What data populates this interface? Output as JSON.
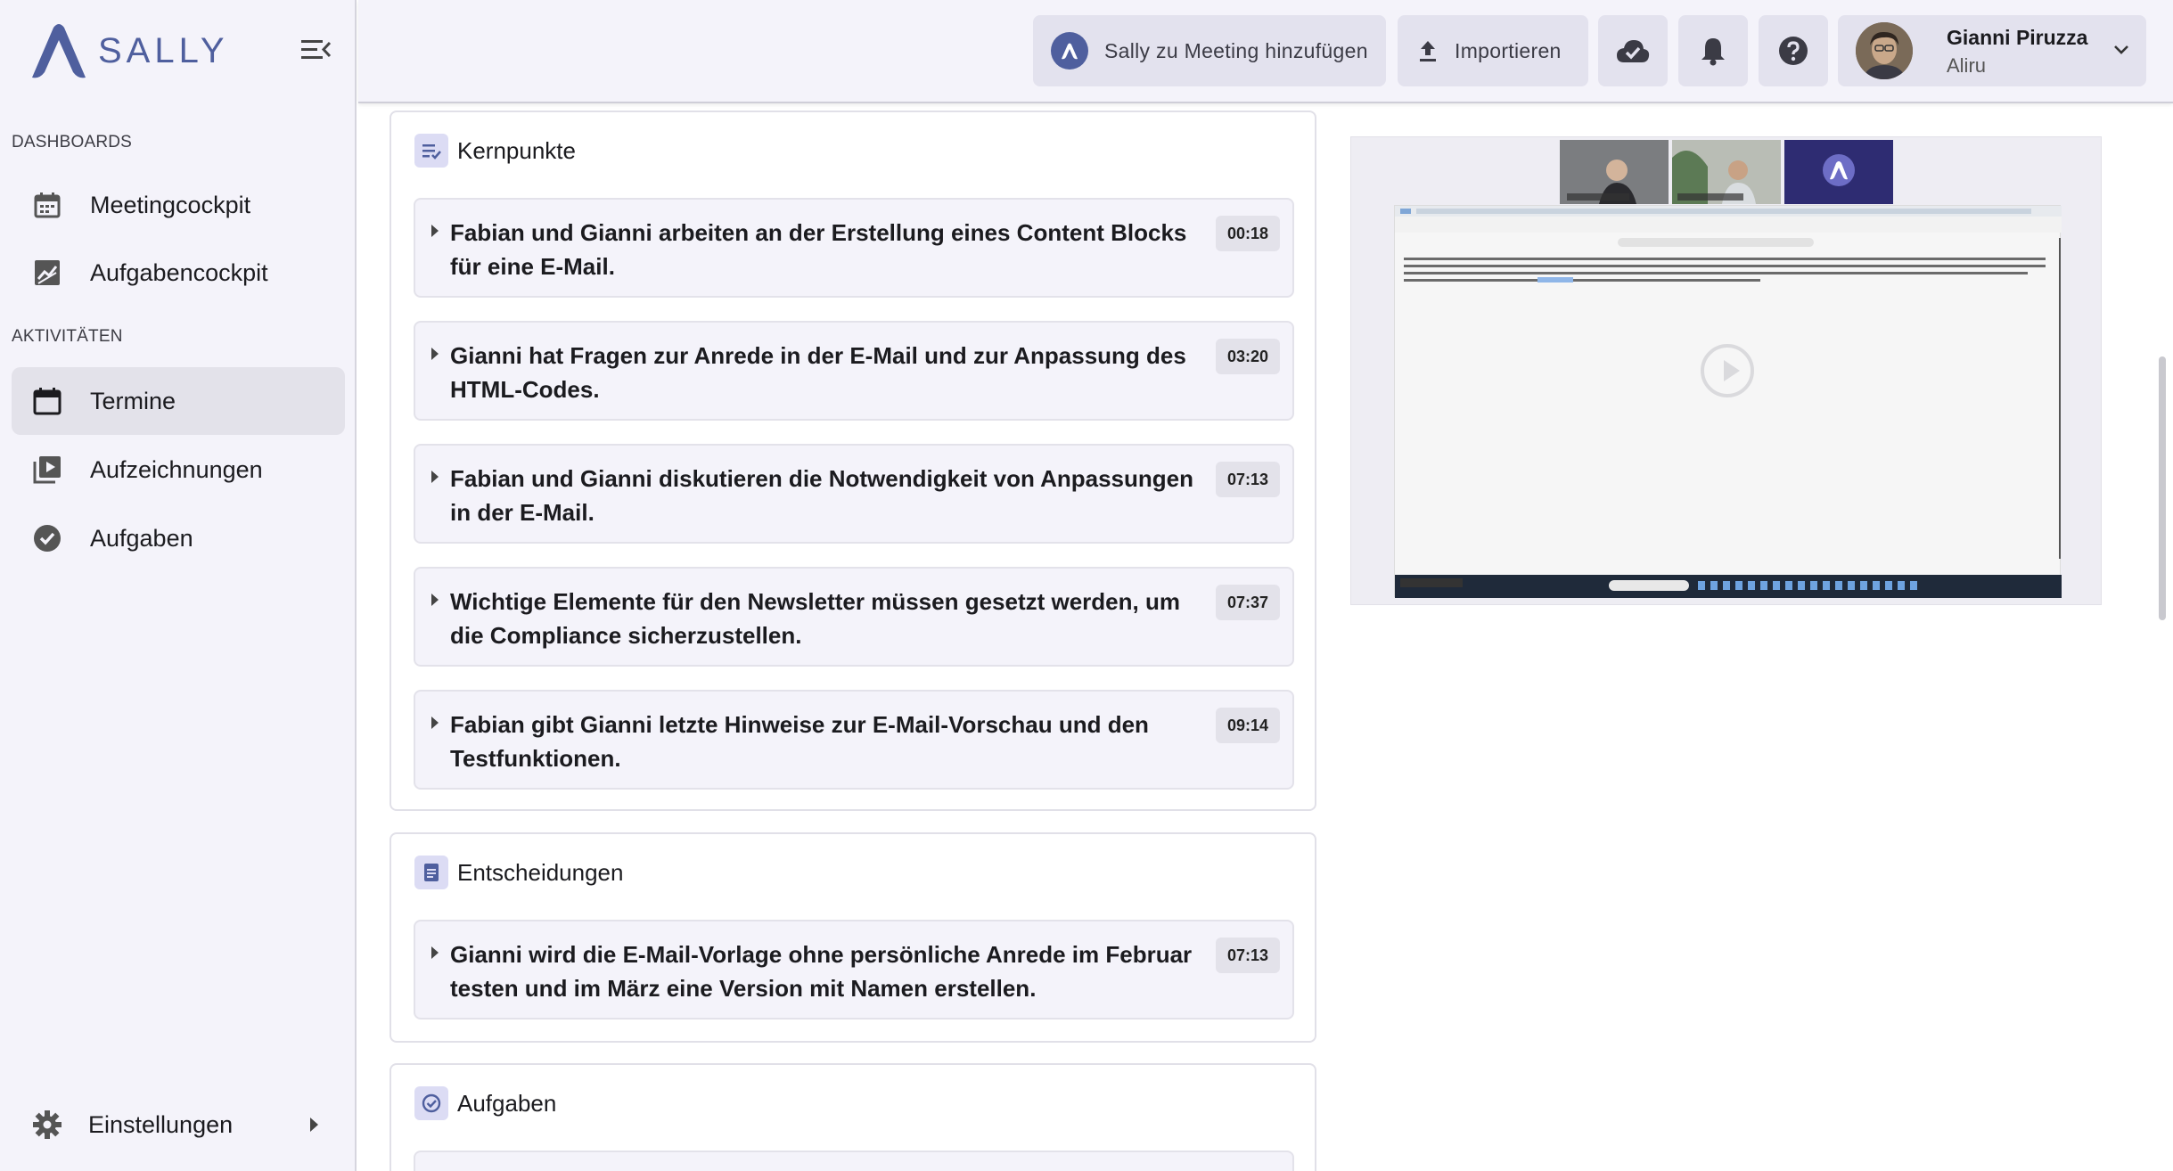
{
  "app": {
    "brand": "SALLY"
  },
  "sidebar": {
    "sections": [
      {
        "label": "DASHBOARDS"
      },
      {
        "label": "AKTIVITÄTEN"
      }
    ],
    "items": [
      {
        "label": "Meetingcockpit",
        "icon": "calendar-grid-icon"
      },
      {
        "label": "Aufgabencockpit",
        "icon": "chart-icon"
      },
      {
        "label": "Termine",
        "icon": "calendar-icon",
        "active": true
      },
      {
        "label": "Aufzeichnungen",
        "icon": "video-library-icon"
      },
      {
        "label": "Aufgaben",
        "icon": "check-circle-icon"
      }
    ],
    "settings": {
      "label": "Einstellungen",
      "icon": "gear-icon"
    }
  },
  "header": {
    "add_meeting_label": "Sally zu Meeting hinzufügen",
    "import_label": "Importieren",
    "user": {
      "name": "Gianni Piruzza",
      "org": "Aliru"
    }
  },
  "kernpunkte": {
    "title": "Kernpunkte",
    "items": [
      {
        "text": "Fabian und Gianni arbeiten an der Erstellung eines Content Blocks für eine E-Mail.",
        "time": "00:18"
      },
      {
        "text": "Gianni hat Fragen zur Anrede in der E-Mail und zur Anpassung des HTML-Codes.",
        "time": "03:20"
      },
      {
        "text": "Fabian und Gianni diskutieren die Notwendigkeit von Anpassungen in der E-Mail.",
        "time": "07:13"
      },
      {
        "text": "Wichtige Elemente für den Newsletter müssen gesetzt werden, um die Compliance sicherzustellen.",
        "time": "07:37"
      },
      {
        "text": "Fabian gibt Gianni letzte Hinweise zur E-Mail-Vorschau und den Testfunktionen.",
        "time": "09:14"
      }
    ]
  },
  "entscheidungen": {
    "title": "Entscheidungen",
    "items": [
      {
        "text": "Gianni wird die E-Mail-Vorlage ohne persönliche Anrede im Februar testen und im März eine Version mit Namen erstellen.",
        "time": "07:13"
      }
    ]
  },
  "aufgaben": {
    "title": "Aufgaben"
  },
  "colors": {
    "accent": "#4f5f9e",
    "sidebar_bg": "#f4f3fa",
    "active_bg": "#e3e2ea"
  }
}
